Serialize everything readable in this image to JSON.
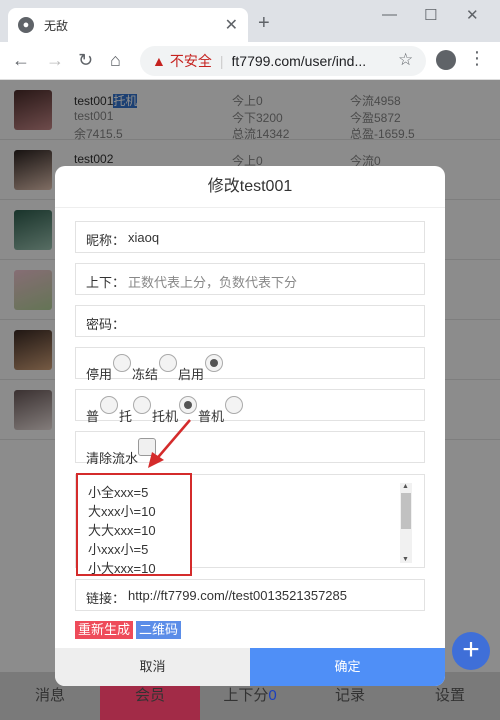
{
  "browser": {
    "tab_title": "无敌",
    "security_label": "不安全",
    "separator": "|",
    "url": "ft7799.com/user/ind..."
  },
  "rows": [
    {
      "name": "test001",
      "tag": "托机",
      "account": "test001",
      "balance": "余7415.5",
      "c2a": "今上0",
      "c2b": "今下3200",
      "c2c": "总流14342",
      "c3a": "今流4958",
      "c3b": "今盈5872",
      "c3c": "总盈-1659.5"
    },
    {
      "name": "test002",
      "c2a": "今上0",
      "c3a": "今流0"
    }
  ],
  "modal": {
    "title": "修改test001",
    "nickname_label": "昵称：",
    "nickname_value": "xiaoq",
    "updown_label": "上下：",
    "updown_placeholder": "正数代表上分，负数代表下分",
    "password_label": "密码：",
    "status": {
      "stop": "停用",
      "freeze": "冻结",
      "enable": "启用",
      "selected": "enable"
    },
    "type": {
      "normal": "普",
      "trustee": "托",
      "trustee_machine": "托机",
      "normal_machine": "普机",
      "selected": "trustee_machine"
    },
    "clear_flow_label": "清除流水",
    "textarea_lines": [
      "小全xxx=5",
      "大xxx小=10",
      "大大xxx=10",
      "小xxx小=5",
      "小大xxx=10"
    ],
    "link_label": "链接：",
    "link_value": "http://ft7799.com//test0013521357285",
    "regenerate_label": "重新生成",
    "qrcode_label": "二维码",
    "cancel_label": "取消",
    "confirm_label": "确定"
  },
  "bottom_nav": {
    "messages": "消息",
    "members": "会员",
    "updown": "上下分",
    "updown_count": "0",
    "records": "记录",
    "settings": "设置"
  },
  "fab_label": "+",
  "colors": {
    "accent": "#4f8ff7",
    "danger": "#ee4b5a",
    "highlight_box": "#d42b2b"
  },
  "icons": [
    "globe-icon",
    "close-icon",
    "plus-icon",
    "back-icon",
    "forward-icon",
    "reload-icon",
    "home-icon",
    "warning-icon",
    "star-icon",
    "account-icon",
    "menu-icon"
  ]
}
